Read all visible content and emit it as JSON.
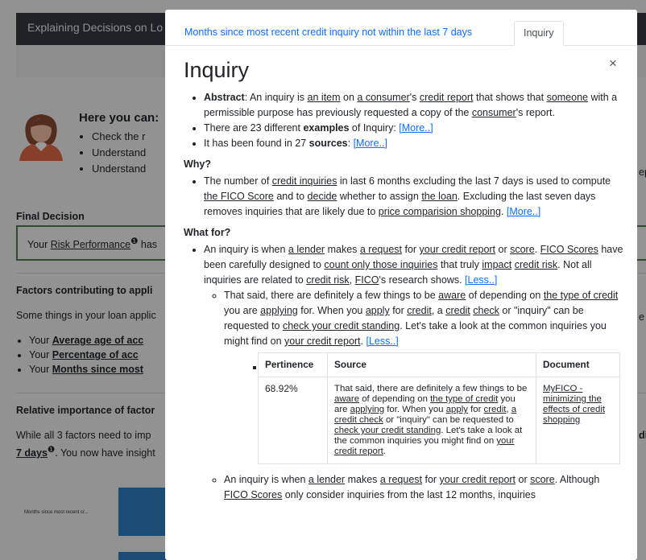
{
  "background": {
    "navbar_title": "Explaining Decisions on Lo",
    "heading": "Here you can:",
    "bullets": [
      "Check the r",
      "Understand",
      "Understand"
    ],
    "final_decision_label": "Final Decision",
    "final_decision_prefix": "Your ",
    "final_decision_link": "Risk Performance",
    "final_decision_suffix": " has",
    "factors_heading": "Factors contributing to appli",
    "factors_intro": "Some things in your loan applic",
    "factor_prefix": "Your ",
    "factors": [
      "Average age of acc",
      "Percentage of acc",
      "Months since most"
    ],
    "importance_heading": "Relative importance of factor",
    "importance_line1": "While all 3 factors need to imp",
    "importance_line2_link": "7 days",
    "importance_line2_rest": ". You now have insight",
    "chart_label": "Months since most recent cr...",
    "right_fragments": [
      "ep",
      "e",
      "di"
    ]
  },
  "modal": {
    "tabs": [
      {
        "label": "Months since most recent credit inquiry not within the last 7 days"
      },
      {
        "label": "Inquiry"
      }
    ],
    "close_symbol": "×",
    "title": "Inquiry",
    "abstract": {
      "label": "Abstract",
      "seg1": ": An inquiry is ",
      "u1": "an item",
      "seg2": " on ",
      "u2": "a consumer",
      "seg3": "'s ",
      "u3": "credit report",
      "seg4": " that shows that ",
      "u4": "someone",
      "seg5": " with a permissible purpose has previously requested a copy of the ",
      "u5": "consumer",
      "seg6": "'s report."
    },
    "examples": {
      "pre": "There are 23 different ",
      "bold": "examples",
      "post": " of Inquiry: ",
      "more": "[More..]"
    },
    "sources": {
      "pre": "It has been found in 27 ",
      "bold": "sources",
      "post": ": ",
      "more": "[More..]"
    },
    "why": {
      "heading": "Why?",
      "seg1": "The number of ",
      "u1": "credit inquiries",
      "seg2": " in last 6 months excluding the last 7 days is used to compute ",
      "u2": "the FICO Score",
      "seg3": " and to ",
      "u3": "decide",
      "seg4": " whether to assign ",
      "u4": "the loan",
      "seg5": ". Excluding the last seven days removes inquiries that are likely due to ",
      "u5": "price comparision shopping",
      "seg6": ". ",
      "more": "[More..]"
    },
    "what_for": {
      "heading": "What for?",
      "seg1": "An inquiry is when ",
      "u1": "a lender",
      "seg2": " makes ",
      "u2": "a request",
      "seg3": " for ",
      "u3": "your credit report",
      "seg4": " or ",
      "u4": "score",
      "seg5": ". ",
      "u5": "FICO Scores",
      "seg6": " have been carefully designed to ",
      "u6": "count only those inquiries",
      "seg7": " that truly ",
      "u7": "impact",
      "seg8": " ",
      "u8": "credit risk",
      "seg9": ". Not all inquiries are related to ",
      "u9": "credit risk",
      "seg10": ", ",
      "u10": "FICO",
      "seg11": "'s research shows. ",
      "less": "[Less..]",
      "sub": {
        "seg1": "That said, there are definitely a few things to be ",
        "u1": "aware",
        "seg2": " of depending on ",
        "u2": "the type of credit",
        "seg3": " you are ",
        "u3": "applying",
        "seg4": " for. When you ",
        "u4": "apply",
        "seg5": " for ",
        "u5": "credit",
        "seg6": ", a ",
        "u6": "credit",
        "seg7": " ",
        "u7": "check",
        "seg8": " or \"inquiry\" can be requested to ",
        "u8": "check your credit standing",
        "seg9": ". Let's take a look at the common inquiries you might find on ",
        "u9": "your credit report",
        "seg10": ". ",
        "less": "[Less..]"
      },
      "table": {
        "headers": [
          "Pertinence",
          "Source",
          "Document"
        ],
        "row": {
          "pertinence": "68.92%",
          "src": {
            "seg1": "That said, there are definitely a few things to be ",
            "u1": "aware",
            "seg2": " of depending on ",
            "u2": "the type of credit",
            "seg3": " you are ",
            "u3": "applying",
            "seg4": " for. When you ",
            "u4": "apply",
            "seg5": " for ",
            "u5": "credit",
            "seg6": ", ",
            "u6": "a credit check",
            "seg7": " or \"inquiry\" can be requested to ",
            "u7": "check your credit standing",
            "seg8": ". Let's take a look at the common inquiries you might find on ",
            "u8": "your credit report",
            "seg9": "."
          },
          "document": "MyFICO - minimizing the effects of credit shopping"
        }
      },
      "sub2": {
        "seg1": "An inquiry is when ",
        "u1": "a lender",
        "seg2": " makes ",
        "u2": "a request",
        "seg3": " for ",
        "u3": "your credit report",
        "seg4": " or ",
        "u4": "score",
        "seg5": ". Although ",
        "u5": "FICO Scores",
        "seg6": " only consider inquiries from the last 12 months, inquiries"
      }
    }
  }
}
